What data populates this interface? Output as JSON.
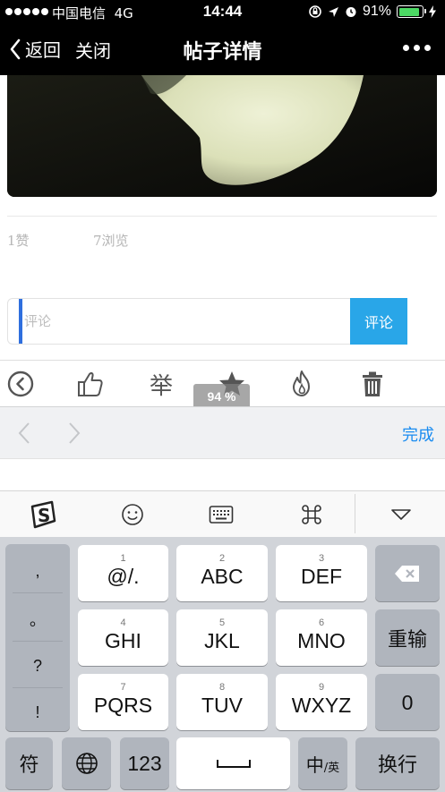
{
  "status_bar": {
    "carrier": "中国电信",
    "network": "4G",
    "time": "14:44",
    "battery_percent": "91%",
    "battery_level": 0.91
  },
  "nav": {
    "back_label": "返回",
    "close_label": "关闭",
    "title": "帖子详情"
  },
  "post": {
    "likes": "1赞",
    "views": "7浏览"
  },
  "comment": {
    "placeholder": "评论",
    "value": "",
    "submit_label": "评论"
  },
  "toolbar": {
    "report_label": "举",
    "zoom_label": "94 %"
  },
  "accessory": {
    "done_label": "完成"
  },
  "keyboard": {
    "punct": [
      ",",
      "。",
      "?",
      "!"
    ],
    "keys": [
      {
        "num": "1",
        "label": "@/."
      },
      {
        "num": "2",
        "label": "ABC"
      },
      {
        "num": "3",
        "label": "DEF"
      },
      {
        "num": "4",
        "label": "GHI"
      },
      {
        "num": "5",
        "label": "JKL"
      },
      {
        "num": "6",
        "label": "MNO"
      },
      {
        "num": "7",
        "label": "PQRS"
      },
      {
        "num": "8",
        "label": "TUV"
      },
      {
        "num": "9",
        "label": "WXYZ"
      }
    ],
    "retype_label": "重输",
    "zero_label": "0",
    "symbol_label": "符",
    "num_label": "123",
    "lang_main": "中",
    "lang_sub": "/英",
    "return_label": "换行"
  },
  "colors": {
    "accent_blue": "#29a6e8",
    "done_blue": "#1a8cf0",
    "cursor_blue": "#2f6fde"
  }
}
